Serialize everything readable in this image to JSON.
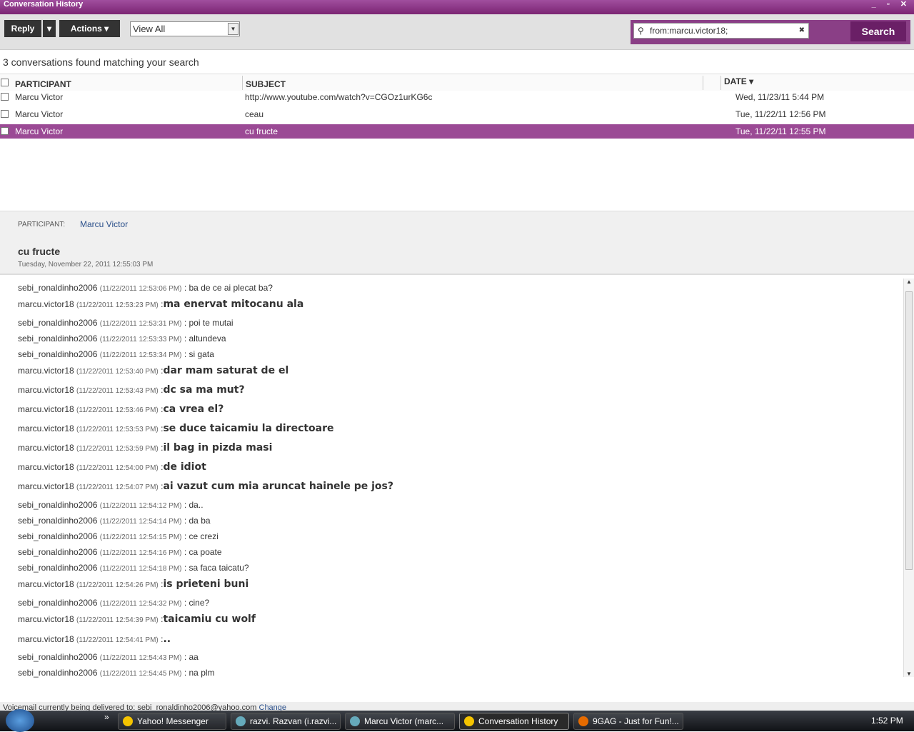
{
  "window": {
    "title": "Conversation History",
    "controls": "_ ▫ ✕"
  },
  "toolbar": {
    "reply": "Reply",
    "reply_menu": "▾",
    "actions": "Actions ▾",
    "view": "View All",
    "search_value": "from:marcu.victor18;",
    "search_clear": "✖",
    "search": "Search"
  },
  "result_count": "3 conversations found matching your search",
  "columns": {
    "participant": "PARTICIPANT",
    "subject": "SUBJECT",
    "date": "DATE ▾"
  },
  "rows": [
    {
      "participant": "Marcu Victor",
      "subject": "http://www.youtube.com/watch?v=CGOz1urKG6c",
      "date": "Wed, 11/23/11 5:44 PM"
    },
    {
      "participant": "Marcu Victor",
      "subject": "ceau",
      "date": "Tue, 11/22/11 12:56 PM"
    },
    {
      "participant": "Marcu Victor",
      "subject": "cu fructe",
      "date": "Tue, 11/22/11 12:55 PM"
    }
  ],
  "detail": {
    "participant_label": "PARTICIPANT:",
    "participant": "Marcu Victor",
    "subject": "cu fructe",
    "date": "Tuesday, November 22, 2011 12:55:03 PM"
  },
  "messages": [
    {
      "from": "sebi_ronaldinho2006",
      "ts": "(11/22/2011 12:53:06 PM)",
      "text": ": ba de ce ai plecat ba?"
    },
    {
      "from": "marcu.victor18",
      "ts": "(11/22/2011 12:53:23 PM)",
      "text": "ma enervat mitocanu ala"
    },
    {
      "from": "sebi_ronaldinho2006",
      "ts": "(11/22/2011 12:53:31 PM)",
      "text": ": poi te mutai"
    },
    {
      "from": "sebi_ronaldinho2006",
      "ts": "(11/22/2011 12:53:33 PM)",
      "text": ": altundeva"
    },
    {
      "from": "sebi_ronaldinho2006",
      "ts": "(11/22/2011 12:53:34 PM)",
      "text": ": si gata"
    },
    {
      "from": "marcu.victor18",
      "ts": "(11/22/2011 12:53:40 PM)",
      "text": "dar mam saturat de el"
    },
    {
      "from": "marcu.victor18",
      "ts": "(11/22/2011 12:53:43 PM)",
      "text": "dc sa ma mut?"
    },
    {
      "from": "marcu.victor18",
      "ts": "(11/22/2011 12:53:46 PM)",
      "text": "ca vrea el?"
    },
    {
      "from": "marcu.victor18",
      "ts": "(11/22/2011 12:53:53 PM)",
      "text": "se duce taicamiu la directoare"
    },
    {
      "from": "marcu.victor18",
      "ts": "(11/22/2011 12:53:59 PM)",
      "text": "il bag in pizda masi"
    },
    {
      "from": "marcu.victor18",
      "ts": "(11/22/2011 12:54:00 PM)",
      "text": "de idiot"
    },
    {
      "from": "marcu.victor18",
      "ts": "(11/22/2011 12:54:07 PM)",
      "text": "ai vazut cum mia aruncat hainele pe jos?"
    },
    {
      "from": "sebi_ronaldinho2006",
      "ts": "(11/22/2011 12:54:12 PM)",
      "text": ": da.."
    },
    {
      "from": "sebi_ronaldinho2006",
      "ts": "(11/22/2011 12:54:14 PM)",
      "text": ": da ba"
    },
    {
      "from": "sebi_ronaldinho2006",
      "ts": "(11/22/2011 12:54:15 PM)",
      "text": ": ce crezi"
    },
    {
      "from": "sebi_ronaldinho2006",
      "ts": "(11/22/2011 12:54:16 PM)",
      "text": ": ca poate"
    },
    {
      "from": "sebi_ronaldinho2006",
      "ts": "(11/22/2011 12:54:18 PM)",
      "text": ": sa faca taicatu?"
    },
    {
      "from": "marcu.victor18",
      "ts": "(11/22/2011 12:54:26 PM)",
      "text": "is prieteni buni"
    },
    {
      "from": "sebi_ronaldinho2006",
      "ts": "(11/22/2011 12:54:32 PM)",
      "text": ": cine?"
    },
    {
      "from": "marcu.victor18",
      "ts": "(11/22/2011 12:54:39 PM)",
      "text": "taicamiu cu wolf"
    },
    {
      "from": "marcu.victor18",
      "ts": "(11/22/2011 12:54:41 PM)",
      "text": ".."
    },
    {
      "from": "sebi_ronaldinho2006",
      "ts": "(11/22/2011 12:54:43 PM)",
      "text": ": aa"
    },
    {
      "from": "sebi_ronaldinho2006",
      "ts": "(11/22/2011 12:54:45 PM)",
      "text": ": na plm"
    }
  ],
  "footer": {
    "text": "Voicemail currently being delivered to: sebi_ronaldinho2006@yahoo.com",
    "change": "Change"
  },
  "taskbar": {
    "more": "»",
    "tasks": [
      "Yahoo! Messenger",
      "razvi. Razvan (i.razvi...",
      "Marcu Victor (marc...",
      "Conversation History",
      "9GAG - Just for Fun!..."
    ],
    "clock": "1:52 PM"
  },
  "colors": {
    "accent": "#9b4a95",
    "title": "#7b2573"
  }
}
